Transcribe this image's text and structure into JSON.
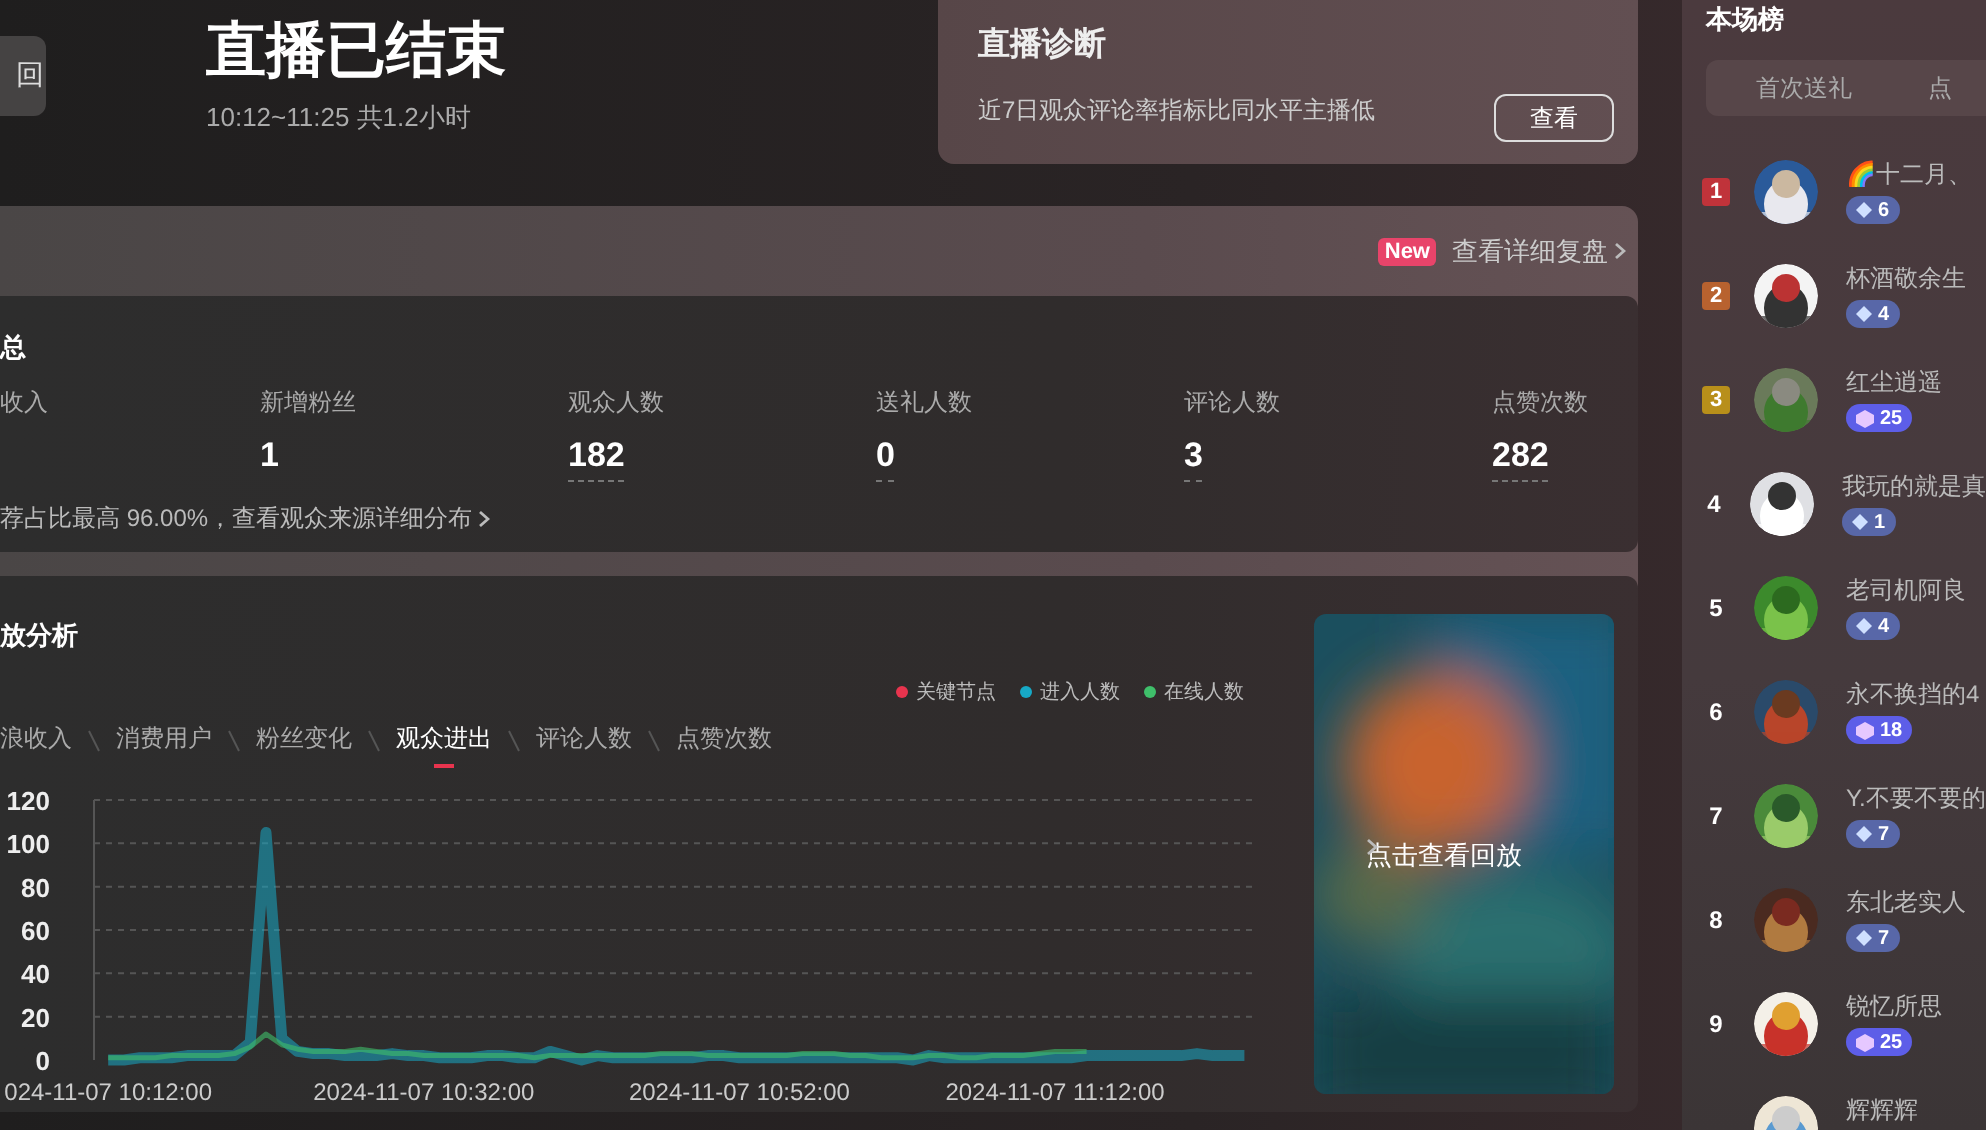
{
  "header": {
    "back_button": "回",
    "title": "直播已结束",
    "subtitle": "10:12~11:25 共1.2小时"
  },
  "diagnosis": {
    "title": "直播诊断",
    "text": "近7日观众评论率指标比同水平主播低",
    "button": "查看"
  },
  "review_bar": {
    "badge": "New",
    "link": "查看详细复盘"
  },
  "summary": {
    "title": "总",
    "metrics": [
      {
        "label": "收入"
      },
      {
        "label": "新增粉丝",
        "value": "1",
        "underlined": false
      },
      {
        "label": "观众人数",
        "value": "182",
        "underlined": true
      },
      {
        "label": "送礼人数",
        "value": "0",
        "underlined": true
      },
      {
        "label": "评论人数",
        "value": "3",
        "underlined": true
      },
      {
        "label": "点赞次数",
        "value": "282",
        "underlined": true
      }
    ],
    "note": "荐占比最高 96.00%，查看观众来源详细分布"
  },
  "analysis": {
    "title": "放分析",
    "tabs": [
      {
        "label": "浪收入",
        "selected": false
      },
      {
        "label": "消费用户",
        "selected": false
      },
      {
        "label": "粉丝变化",
        "selected": false
      },
      {
        "label": "观众进出",
        "selected": true
      },
      {
        "label": "评论人数",
        "selected": false
      },
      {
        "label": "点赞次数",
        "selected": false
      }
    ],
    "legend": [
      {
        "label": "关键节点",
        "color": "#e8344e"
      }
    ],
    "chart_data": {
      "type": "line",
      "categories": [
        "024-11-07 10:12:00",
        null,
        null,
        null,
        null,
        null,
        null,
        null,
        null,
        null,
        null,
        null,
        null,
        null,
        null,
        null,
        null,
        null,
        null,
        null,
        "2024-11-07 10:32:00",
        null,
        null,
        null,
        null,
        null,
        null,
        null,
        null,
        null,
        null,
        null,
        null,
        null,
        null,
        null,
        null,
        null,
        null,
        null,
        "2024-11-07 10:52:00",
        null,
        null,
        null,
        null,
        null,
        null,
        null,
        null,
        null,
        null,
        null,
        null,
        null,
        null,
        null,
        null,
        null,
        null,
        null,
        "2024-11-07 11:12:00",
        null,
        null,
        null,
        null,
        null,
        null,
        null,
        null,
        null,
        null,
        null,
        null
      ],
      "series": [
        {
          "name": "进入人数",
          "color": "#17a9c6",
          "values": [
            0,
            0,
            1,
            1,
            1,
            2,
            2,
            2,
            2,
            8,
            105,
            10,
            4,
            3,
            3,
            2,
            2,
            2,
            3,
            2,
            2,
            1,
            1,
            1,
            2,
            2,
            1,
            1,
            4,
            2,
            0,
            2,
            1,
            1,
            1,
            1,
            1,
            1,
            2,
            2,
            1,
            1,
            1,
            1,
            1,
            1,
            1,
            1,
            1,
            1,
            1,
            0,
            2,
            1,
            1,
            1,
            1,
            1,
            1,
            1,
            1,
            1,
            2,
            2,
            2,
            2,
            2,
            2,
            2,
            3,
            2,
            2,
            2
          ]
        },
        {
          "name": "在线人数",
          "color": "#3fbf6a",
          "values": [
            1,
            1,
            1,
            1,
            2,
            2,
            2,
            2,
            3,
            6,
            12,
            7,
            5,
            4,
            4,
            4,
            5,
            4,
            3,
            3,
            2,
            2,
            2,
            2,
            2,
            2,
            2,
            1,
            2,
            2,
            2,
            2,
            2,
            2,
            2,
            3,
            3,
            3,
            2,
            2,
            2,
            2,
            2,
            2,
            3,
            3,
            3,
            2,
            2,
            1,
            1,
            1,
            2,
            2,
            1,
            1,
            2,
            2,
            2,
            3,
            4,
            4,
            4,
            null,
            null,
            null,
            null,
            null,
            null,
            null,
            null,
            null,
            null
          ]
        }
      ],
      "ylim": [
        0,
        120
      ],
      "yticks": [
        0,
        20,
        40,
        60,
        80,
        100,
        120
      ],
      "grid": true
    },
    "replay": {
      "kind": "picture",
      "label": "点击查看回放"
    }
  },
  "ranking": {
    "title": "本场榜",
    "tabs": [
      {
        "label": "首次送礼",
        "selected": false
      },
      {
        "label": "点",
        "selected": false
      }
    ],
    "entries": [
      {
        "rank": "1",
        "color": "#c0333a",
        "name": "🌈十二月、",
        "gift": "6",
        "kind": "diamond"
      },
      {
        "rank": "2",
        "color": "#b8622f",
        "name": "杯酒敬余生",
        "gift": "4",
        "kind": "diamond"
      },
      {
        "rank": "3",
        "color": "#b88f1a",
        "name": "红尘逍遥",
        "gift": "25",
        "kind": "crystal"
      },
      {
        "rank": "4",
        "name": "我玩的就是真",
        "gift": "1",
        "kind": "diamond"
      },
      {
        "rank": "5",
        "name": "老司机阿良",
        "gift": "4",
        "kind": "diamond"
      },
      {
        "rank": "6",
        "name": "永不换挡的4",
        "gift": "18",
        "kind": "crystal"
      },
      {
        "rank": "7",
        "name": "Y.不要不要的",
        "gift": "7",
        "kind": "diamond"
      },
      {
        "rank": "8",
        "name": "东北老实人",
        "gift": "7",
        "kind": "diamond"
      },
      {
        "rank": "9",
        "name": "锐忆所思",
        "gift": "25",
        "kind": "crystal"
      },
      {
        "name": "辉辉辉"
      }
    ]
  }
}
